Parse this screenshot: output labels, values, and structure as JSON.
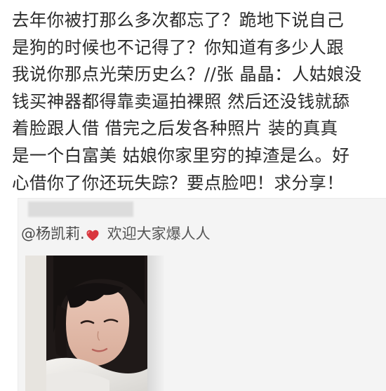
{
  "post": {
    "lines": [
      "去年你被打那么多次都忘了？跪地下说自己",
      "是狗的时候也不记得了？你知道有多少人跟",
      "我说你那点光荣历史么？//张 晶晶：人姑娘没",
      "钱买神器都得靠卖逼拍裸照 然后还没钱就舔",
      "着脸跟人借 借完之后发各种照片 装的真真",
      "是一个白富美 姑娘你家里穷的掉渣是么。好",
      "心借你了你还玩失踪？要点脸吧！求分享！"
    ]
  },
  "repost": {
    "mention": "@杨凯莉.",
    "heart_icon": "heart-icon",
    "heart_color": "#d9363e",
    "text": "欢迎大家爆人人"
  },
  "colors": {
    "text": "#2b2b2b",
    "card_bg": "#f4f4f4",
    "card_text": "#555555"
  }
}
